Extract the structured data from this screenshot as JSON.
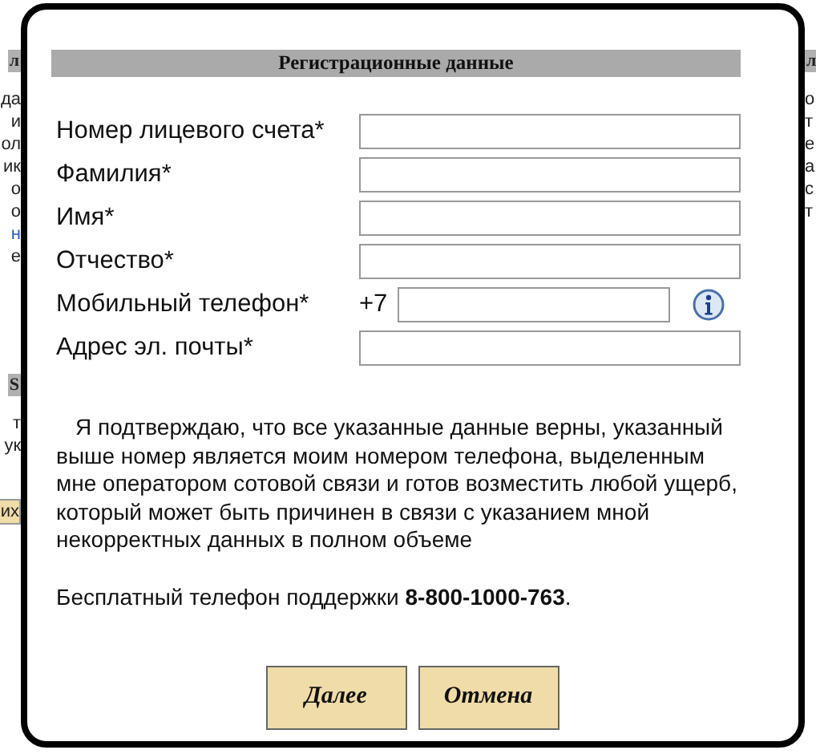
{
  "background_page": {
    "left_fragments": [
      {
        "text": "л",
        "kind": "header"
      },
      {
        "text": "да",
        "kind": "line"
      },
      {
        "text": "и",
        "kind": "line"
      },
      {
        "text": "ол",
        "kind": "line"
      },
      {
        "text": "ик",
        "kind": "line"
      },
      {
        "text": "о",
        "kind": "line"
      },
      {
        "text": "о",
        "kind": "line"
      },
      {
        "text": "н",
        "kind": "link"
      },
      {
        "text": "е",
        "kind": "line"
      },
      {
        "text": "S",
        "kind": "header"
      },
      {
        "text": "т",
        "kind": "line"
      },
      {
        "text": "ук",
        "kind": "line"
      },
      {
        "text": "их",
        "kind": "button"
      }
    ],
    "right_fragments": [
      {
        "text": "л",
        "kind": "header"
      },
      {
        "text": "о",
        "kind": "line"
      },
      {
        "text": "т",
        "kind": "line"
      },
      {
        "text": "е",
        "kind": "line"
      },
      {
        "text": "а",
        "kind": "line"
      },
      {
        "text": "с",
        "kind": "line"
      },
      {
        "text": "т",
        "kind": "line"
      }
    ]
  },
  "dialog": {
    "title": "Регистрационные данные",
    "fields": [
      {
        "label": "Номер лицевого счета*",
        "kind": "text"
      },
      {
        "label": "Фамилия*",
        "kind": "text"
      },
      {
        "label": "Имя*",
        "kind": "text"
      },
      {
        "label": "Отчество*",
        "kind": "text"
      },
      {
        "label": "Мобильный телефон*",
        "kind": "phone",
        "prefix": "+7"
      },
      {
        "label": "Адрес эл. почты*",
        "kind": "text"
      }
    ],
    "agreement": "Я подтверждаю, что все указанные данные верны, указанный выше номер является моим номером телефона, выделенным мне оператором сотовой связи и готов возместить любой ущерб, который может быть причинен в связи с указанием мной некорректных данных в полном объеме",
    "support": "Бесплатный телефон поддержки **8-800-1000-763**.",
    "buttons": [
      "Далее",
      "Отмена"
    ]
  }
}
